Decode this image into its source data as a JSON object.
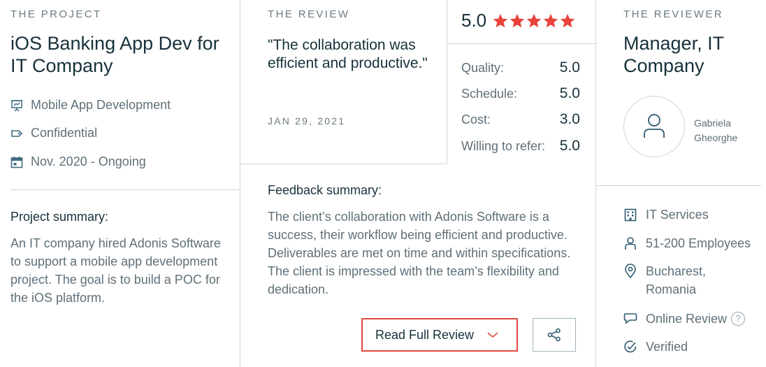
{
  "project": {
    "section_label": "THE PROJECT",
    "title": "iOS Banking App Dev for IT Company",
    "service": "Mobile App Development",
    "budget": "Confidential",
    "dates": "Nov. 2020 - Ongoing",
    "summary_heading": "Project summary:",
    "summary_text": "An IT company hired Adonis Software to support a mobile app development project. The goal is to build a POC for the iOS platform."
  },
  "review": {
    "section_label": "THE REVIEW",
    "quote": "\"The collaboration was efficient and productive.\"",
    "date": "JAN 29, 2021",
    "overall": "5.0",
    "stars": 5,
    "scores": [
      {
        "label": "Quality:",
        "value": "5.0"
      },
      {
        "label": "Schedule:",
        "value": "5.0"
      },
      {
        "label": "Cost:",
        "value": "3.0"
      },
      {
        "label": "Willing to refer:",
        "value": "5.0"
      }
    ],
    "feedback_heading": "Feedback summary:",
    "feedback_text": "The client’s collaboration with Adonis Software is a success, their workflow being efficient and productive. Deliverables are met on time and within specifications. The client is impressed with the team’s flexibility and dedication.",
    "read_full_label": "Read Full Review"
  },
  "reviewer": {
    "section_label": "THE REVIEWER",
    "title": "Manager, IT Company",
    "name": "Gabriela Gheorghe",
    "industry": "IT Services",
    "size": "51-200 Employees",
    "location": "Bucharest, Romania",
    "review_type": "Online Review",
    "help_mark": "?",
    "verified": "Verified"
  },
  "colors": {
    "star": "#e8423a",
    "button_border": "#e04a3f",
    "divider": "#cbd6dc",
    "heading": "#17313b",
    "muted": "#5f6f78"
  },
  "icons": {
    "service": "presentation-board-icon",
    "budget": "price-tag-icon",
    "dates": "calendar-icon",
    "share": "share-icon",
    "chevron": "chevron-down-icon",
    "avatar": "user-icon",
    "industry": "building-icon",
    "size": "person-icon",
    "location": "map-pin-icon",
    "review_type": "chat-bubble-icon",
    "verified": "check-circle-icon"
  }
}
